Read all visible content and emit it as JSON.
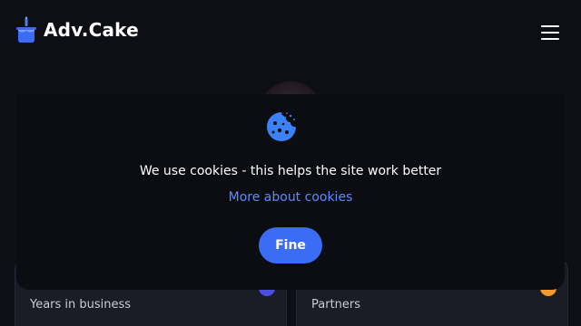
{
  "header": {
    "brand": "Adv.Cake",
    "logo_icon": "cake-icon",
    "menu_icon": "hamburger-menu-icon"
  },
  "cookie_banner": {
    "icon": "cookie-icon",
    "message": "We use cookies - this helps the site work better",
    "more_link": "More about cookies",
    "accept_label": "Fine"
  },
  "stats": [
    {
      "label": "Years in business"
    },
    {
      "label": "Partners"
    }
  ],
  "colors": {
    "background": "#0e0f14",
    "accent": "#3b6cf6",
    "link": "#5b8cff",
    "cookie_blue": "#3b82f6"
  }
}
